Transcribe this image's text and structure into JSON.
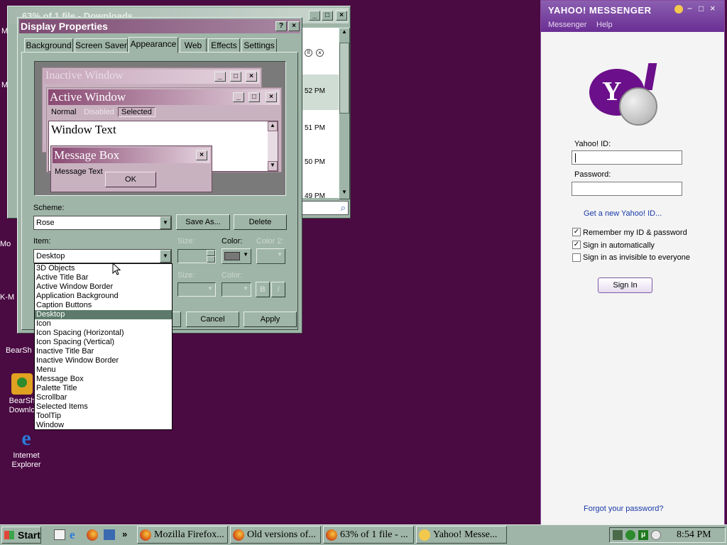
{
  "desktop": {
    "icons": [
      {
        "label": "Mo",
        "name": "mozilla-icon"
      },
      {
        "label": "K-M",
        "name": "kmeleon-icon"
      },
      {
        "label": "BearSh",
        "name": "bearshare-icon"
      },
      {
        "label": "BearSh Downlo",
        "name": "bearshare-downloads-icon"
      },
      {
        "label": "Internet Explorer",
        "name": "internet-explorer-icon"
      }
    ],
    "left_fragments": [
      "M",
      "M"
    ]
  },
  "downloads_window": {
    "title": "63% of 1 file - Downloads",
    "times": [
      "52 PM",
      "51 PM",
      "50 PM",
      "49 PM"
    ]
  },
  "display_properties": {
    "title": "Display Properties",
    "help_btn": "?",
    "close_btn": "×",
    "tabs": [
      "Background",
      "Screen Saver",
      "Appearance",
      "Web",
      "Effects",
      "Settings"
    ],
    "preview": {
      "inactive_title": "Inactive Window",
      "active_title": "Active Window",
      "menu": [
        "Normal",
        "Disabled",
        "Selected"
      ],
      "window_text": "Window Text",
      "message_box_title": "Message Box",
      "message_text": "Message Text",
      "ok": "OK"
    },
    "scheme_label": "Scheme:",
    "scheme_value": "Rose",
    "save_as": "Save As...",
    "delete": "Delete",
    "item_label": "Item:",
    "item_value": "Desktop",
    "size_label": "Size:",
    "color_label": "Color:",
    "color2_label": "Color 2:",
    "font_size_label": "Size:",
    "font_color_label": "Color:",
    "bold": "B",
    "italic": "I",
    "cancel": "Cancel",
    "apply": "Apply",
    "item_options": [
      "3D Objects",
      "Active Title Bar",
      "Active Window Border",
      "Application Background",
      "Caption Buttons",
      "Desktop",
      "Icon",
      "Icon Spacing (Horizontal)",
      "Icon Spacing (Vertical)",
      "Inactive Title Bar",
      "Inactive Window Border",
      "Menu",
      "Message Box",
      "Palette Title",
      "Scrollbar",
      "Selected Items",
      "ToolTip",
      "Window"
    ],
    "selected_item": "Desktop"
  },
  "yahoo": {
    "title": "YAHOO! MESSENGER",
    "menu": [
      "Messenger",
      "Help"
    ],
    "id_label": "Yahoo! ID:",
    "id_value": "",
    "password_label": "Password:",
    "get_new_id": "Get a new Yahoo! ID...",
    "remember": "Remember my ID & password",
    "sign_in_auto": "Sign in automatically",
    "invisible": "Sign in as invisible to everyone",
    "remember_checked": true,
    "auto_checked": true,
    "invisible_checked": false,
    "sign_in_btn": "Sign In",
    "forgot": "Forgot your password?",
    "colors": {
      "purple": "#7b0099",
      "panel": "#f4f4f4",
      "link": "#1a3aa8"
    }
  },
  "taskbar": {
    "start": "Start",
    "tasks": [
      "Mozilla Firefox...",
      "Old versions of...",
      "63% of 1 file - ...",
      "Yahoo! Messe..."
    ],
    "clock": "8:54 PM",
    "more": "»"
  },
  "colors": {
    "desktop": "#4a0a42",
    "window_face": "#9fb5a8",
    "active_title": "#8c4670",
    "selected": "#5d7a6c"
  }
}
